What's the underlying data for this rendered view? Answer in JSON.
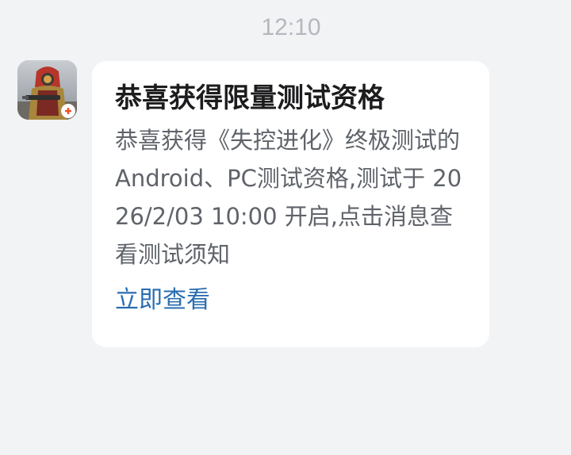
{
  "timestamp": "12:10",
  "message": {
    "avatar_icon": "game-app-icon",
    "title": "恭喜获得限量测试资格",
    "body": "恭喜获得《失控进化》终极测试的Android、PC测试资格,测试于 2026/2/03 10:00 开启,点击消息查看测试须知",
    "action_label": "立即查看"
  },
  "colors": {
    "background": "#f2f3f5",
    "bubble": "#ffffff",
    "link": "#2a6db0",
    "title": "#1c1c1e",
    "body": "#5f636a",
    "timestamp": "#b4b8be"
  }
}
